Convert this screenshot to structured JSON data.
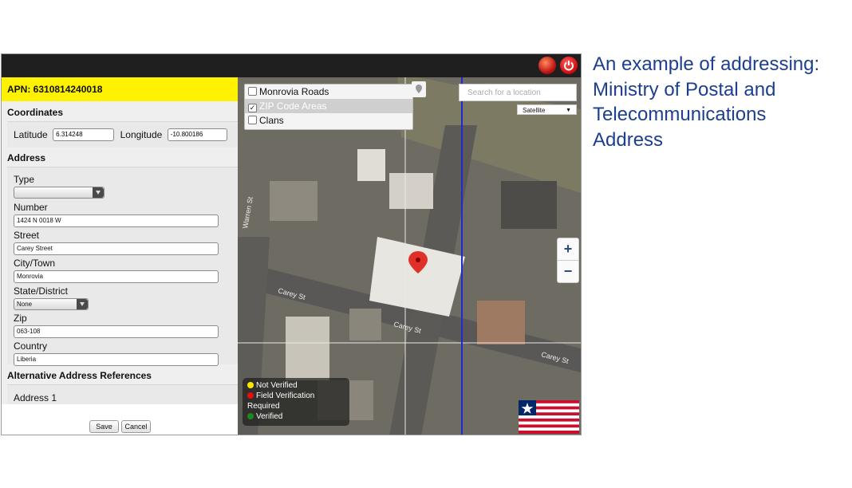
{
  "caption": {
    "lines": [
      "An example of addressing:",
      "Ministry of Postal and",
      "Telecommunications",
      "Address"
    ]
  },
  "topbar": {
    "icons": [
      "globe-icon",
      "power-icon"
    ]
  },
  "panel": {
    "apn": "APN: 6310814240018",
    "coordinates": {
      "heading": "Coordinates",
      "latitude_label": "Latitude",
      "latitude_value": "6.314248",
      "longitude_label": "Longitude",
      "longitude_value": "-10.800186"
    },
    "address": {
      "heading": "Address",
      "type_label": "Type",
      "type_value": "",
      "number_label": "Number",
      "number_value": "1424 N 0018 W",
      "street_label": "Street",
      "street_value": "Carey Street",
      "city_label": "City/Town",
      "city_value": "Monrovia",
      "state_label": "State/District",
      "state_value": "None",
      "zip_label": "Zip",
      "zip_value": "063-108",
      "country_label": "Country",
      "country_value": "Liberia"
    },
    "alt": {
      "heading": "Alternative Address References",
      "item1": "Address 1"
    },
    "buttons": {
      "save": "Save",
      "cancel": "Cancel"
    }
  },
  "map": {
    "layers": [
      {
        "label": "Monrovia Roads",
        "checked": false
      },
      {
        "label": "ZIP Code Areas",
        "checked": true
      },
      {
        "label": "Clans",
        "checked": false
      }
    ],
    "search_placeholder": "Search for a location",
    "map_type": "Satellite",
    "zoom_in": "+",
    "zoom_out": "−",
    "street_labels": [
      "Carey St",
      "Carey St",
      "Carey St",
      "Warren St"
    ],
    "legend": {
      "not_verified": "Not Verified",
      "field_verification": "Field Verification",
      "required": "Required",
      "verified": "Verified"
    },
    "colors": {
      "apn_bg": "#fff200",
      "not_verified": "#ffe600",
      "field_verification": "#e01010",
      "verified": "#1a8a1a",
      "zip_boundary": "#1f2bd0",
      "caption": "#1d3f8f"
    }
  }
}
